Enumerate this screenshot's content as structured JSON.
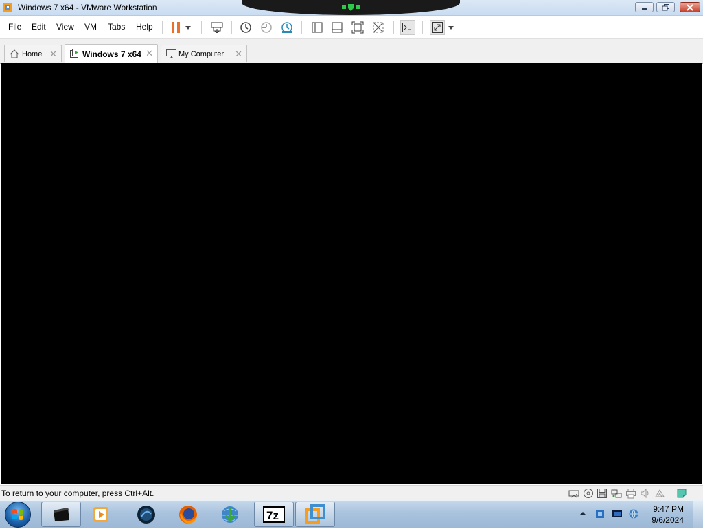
{
  "window": {
    "title": "Windows 7 x64 - VMware Workstation"
  },
  "menu": {
    "file": "File",
    "edit": "Edit",
    "view": "View",
    "vm": "VM",
    "tabs": "Tabs",
    "help": "Help"
  },
  "tabs": [
    {
      "label": "Home",
      "icon": "home-icon",
      "active": false
    },
    {
      "label": "Windows 7 x64",
      "icon": "vm-icon",
      "active": true
    },
    {
      "label": "My Computer",
      "icon": "computer-icon",
      "active": false
    }
  ],
  "status": {
    "message": "To return to your computer, press Ctrl+Alt."
  },
  "clock": {
    "time": "9:47 PM",
    "date": "9/6/2024"
  },
  "colors": {
    "accent_pause": "#e8712b",
    "vm_background": "#000000",
    "taskbar": "#a9c3de"
  },
  "taskbar_apps": [
    "black-app-icon",
    "media-player-icon",
    "bluish-app-icon",
    "firefox-icon",
    "internet-download-manager-icon",
    "7zip-icon",
    "vmware-icon"
  ]
}
